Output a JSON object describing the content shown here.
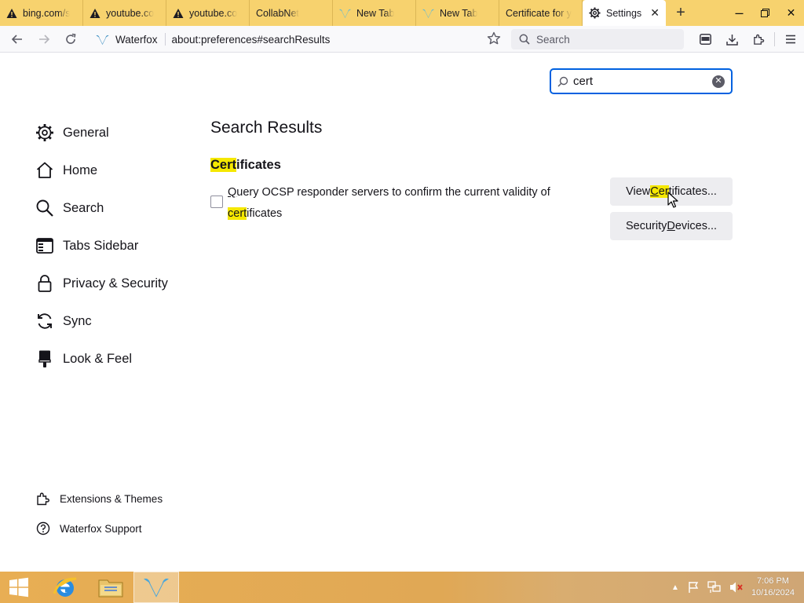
{
  "tabs": [
    {
      "title": "bing.com/s",
      "icon": "warning-icon"
    },
    {
      "title": "youtube.co",
      "icon": "warning-icon"
    },
    {
      "title": "youtube.co",
      "icon": "warning-icon"
    },
    {
      "title": "CollabNet",
      "icon": ""
    },
    {
      "title": "New Tab",
      "icon": "waterfox-icon"
    },
    {
      "title": "New Tab",
      "icon": "waterfox-icon"
    },
    {
      "title": "Certificate for y",
      "icon": ""
    }
  ],
  "active_tab": {
    "title": "Settings",
    "icon": "gear-icon"
  },
  "toolbar": {
    "identity": "Waterfox",
    "url": "about:preferences#searchResults",
    "search_placeholder": "Search"
  },
  "find": {
    "value": "cert"
  },
  "nav": {
    "items": [
      {
        "label": "General",
        "icon": "gear-icon"
      },
      {
        "label": "Home",
        "icon": "home-icon"
      },
      {
        "label": "Search",
        "icon": "search-icon"
      },
      {
        "label": "Tabs Sidebar",
        "icon": "sidebar-icon"
      },
      {
        "label": "Privacy & Security",
        "icon": "lock-icon"
      },
      {
        "label": "Sync",
        "icon": "sync-icon"
      },
      {
        "label": "Look & Feel",
        "icon": "paintbrush-icon"
      }
    ],
    "footer": [
      {
        "label": "Extensions & Themes",
        "icon": "puzzle-icon"
      },
      {
        "label": "Waterfox Support",
        "icon": "help-icon"
      }
    ]
  },
  "main": {
    "title": "Search Results",
    "section": {
      "hl": "Cert",
      "rest": "ificates"
    },
    "checkbox": {
      "accesskey": "Q",
      "line1_rest": "uery OCSP responder servers to confirm the current validity of",
      "hl": "cert",
      "rest": "ificates",
      "checked": false
    },
    "view_button": {
      "pre": "View ",
      "accesskey": "C",
      "hl": "er",
      "rest": "tificates..."
    },
    "security_button": {
      "pre": "Security ",
      "accesskey": "D",
      "rest": "evices..."
    }
  },
  "taskbar": {
    "time": "7:06 PM",
    "date": "10/16/2024"
  },
  "colors": {
    "tabstrip": "#f7d26e",
    "highlight": "#f5e800",
    "accent": "#0061e0",
    "taskbar": "#e8ae54"
  }
}
